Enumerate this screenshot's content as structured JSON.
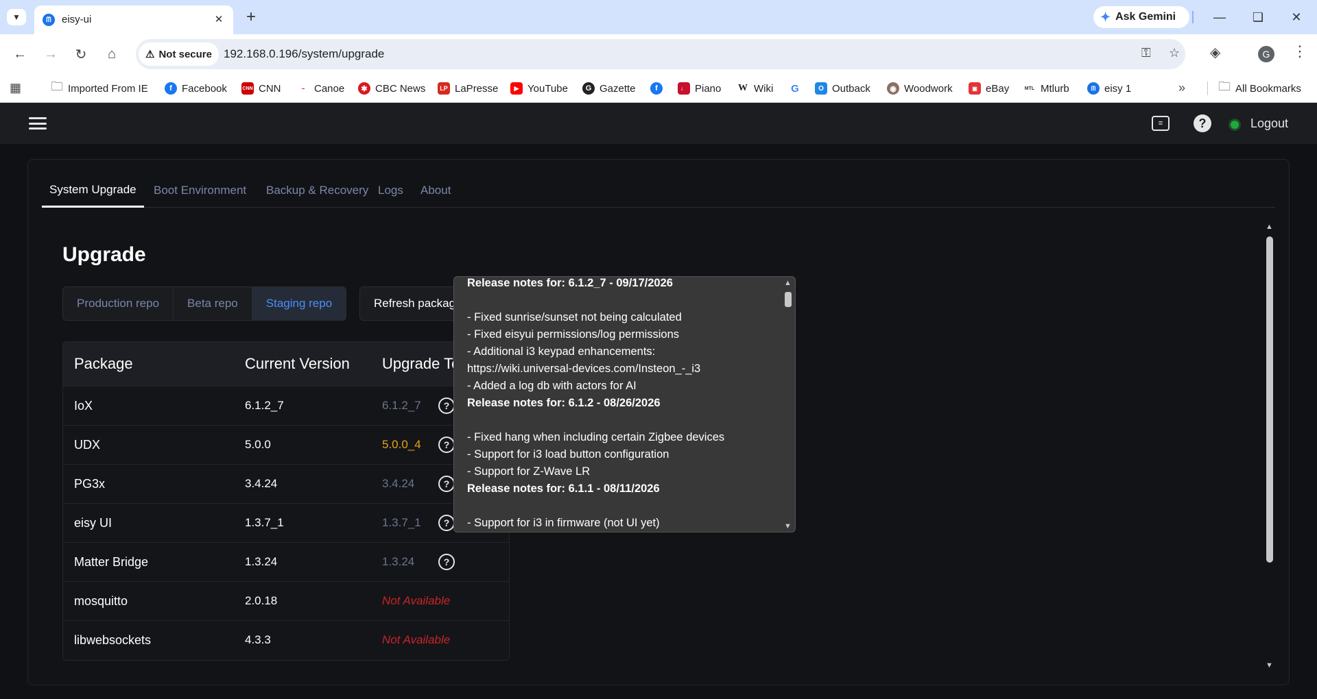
{
  "browser": {
    "tab_title": "eisy-ui",
    "gemini_label": "Ask Gemini",
    "security_label": "Not secure",
    "url": "192.168.0.196/system/upgrade",
    "profile_initial": "G",
    "bookmarks": [
      {
        "label": "Imported From IE",
        "icon": "folder-icon"
      },
      {
        "label": "Facebook",
        "icon": "facebook-icon"
      },
      {
        "label": "CNN",
        "icon": "cnn-icon"
      },
      {
        "label": "Canoe",
        "icon": "canoe-icon"
      },
      {
        "label": "CBC News",
        "icon": "cbc-icon"
      },
      {
        "label": "LaPresse",
        "icon": "lapresse-icon"
      },
      {
        "label": "YouTube",
        "icon": "youtube-icon"
      },
      {
        "label": "Gazette",
        "icon": "gazette-icon"
      },
      {
        "label": "",
        "icon": "facebook-icon"
      },
      {
        "label": "Piano",
        "icon": "piano-icon"
      },
      {
        "label": "Wiki",
        "icon": "wikipedia-icon"
      },
      {
        "label": "",
        "icon": "google-icon"
      },
      {
        "label": "Outback",
        "icon": "outback-icon"
      },
      {
        "label": "Woodwork",
        "icon": "woodwork-icon"
      },
      {
        "label": "eBay",
        "icon": "ebay-icon"
      },
      {
        "label": "Mtlurb",
        "icon": "mtlurb-icon"
      },
      {
        "label": "eisy 1",
        "icon": "eisy-icon"
      }
    ],
    "all_bookmarks_label": "All Bookmarks"
  },
  "header": {
    "logout_label": "Logout",
    "status_color": "#22a83a"
  },
  "nav_tabs": [
    {
      "label": "System Upgrade",
      "active": true
    },
    {
      "label": "Boot Environment",
      "active": false
    },
    {
      "label": "Backup & Recovery",
      "active": false
    },
    {
      "label": "Logs",
      "active": false
    },
    {
      "label": "About",
      "active": false
    }
  ],
  "upgrade": {
    "title": "Upgrade",
    "repos": [
      {
        "label": "Production repo",
        "active": false
      },
      {
        "label": "Beta repo",
        "active": false
      },
      {
        "label": "Staging repo",
        "active": true
      }
    ],
    "refresh_label": "Refresh packages",
    "columns": [
      "Package",
      "Current Version",
      "Upgrade To"
    ],
    "packages": [
      {
        "name": "IoX",
        "current": "6.1.2_7",
        "upgrade": "6.1.2_7",
        "status": "same",
        "help": true
      },
      {
        "name": "UDX",
        "current": "5.0.0",
        "upgrade": "5.0.0_4",
        "status": "available",
        "help": true
      },
      {
        "name": "PG3x",
        "current": "3.4.24",
        "upgrade": "3.4.24",
        "status": "same",
        "help": true
      },
      {
        "name": "eisy UI",
        "current": "1.3.7_1",
        "upgrade": "1.3.7_1",
        "status": "same",
        "help": true
      },
      {
        "name": "Matter Bridge",
        "current": "1.3.24",
        "upgrade": "1.3.24",
        "status": "same",
        "help": true
      },
      {
        "name": "mosquitto",
        "current": "2.0.18",
        "upgrade": "Not Available",
        "status": "na",
        "help": false
      },
      {
        "name": "libwebsockets",
        "current": "4.3.3",
        "upgrade": "Not Available",
        "status": "na",
        "help": false
      }
    ]
  },
  "release_notes": [
    {
      "type": "header",
      "text": "Release notes for: 6.1.2_7  - 09/17/2026"
    },
    {
      "type": "blank",
      "text": ""
    },
    {
      "type": "line",
      "text": "- Fixed sunrise/sunset not being calculated"
    },
    {
      "type": "line",
      "text": "- Fixed eisyui permissions/log permissions"
    },
    {
      "type": "line",
      "text": "- Additional i3 keypad enhancements:"
    },
    {
      "type": "line",
      "text": "https://wiki.universal-devices.com/Insteon_-_i3"
    },
    {
      "type": "line",
      "text": "- Added a log db with actors for AI"
    },
    {
      "type": "header",
      "text": "Release notes for: 6.1.2  - 08/26/2026"
    },
    {
      "type": "blank",
      "text": ""
    },
    {
      "type": "line",
      "text": "- Fixed hang when including certain Zigbee devices"
    },
    {
      "type": "line",
      "text": "- Support for i3 load button configuration"
    },
    {
      "type": "line",
      "text": "- Support for Z-Wave LR"
    },
    {
      "type": "header",
      "text": "Release notes for: 6.1.1  - 08/11/2026"
    },
    {
      "type": "blank",
      "text": ""
    },
    {
      "type": "line",
      "text": "- Support for i3 in firmware (not UI yet)"
    }
  ],
  "colors": {
    "accent": "#4a8ff5",
    "available": "#e8a317",
    "not_available": "#c8242a",
    "muted": "#6b7590"
  }
}
